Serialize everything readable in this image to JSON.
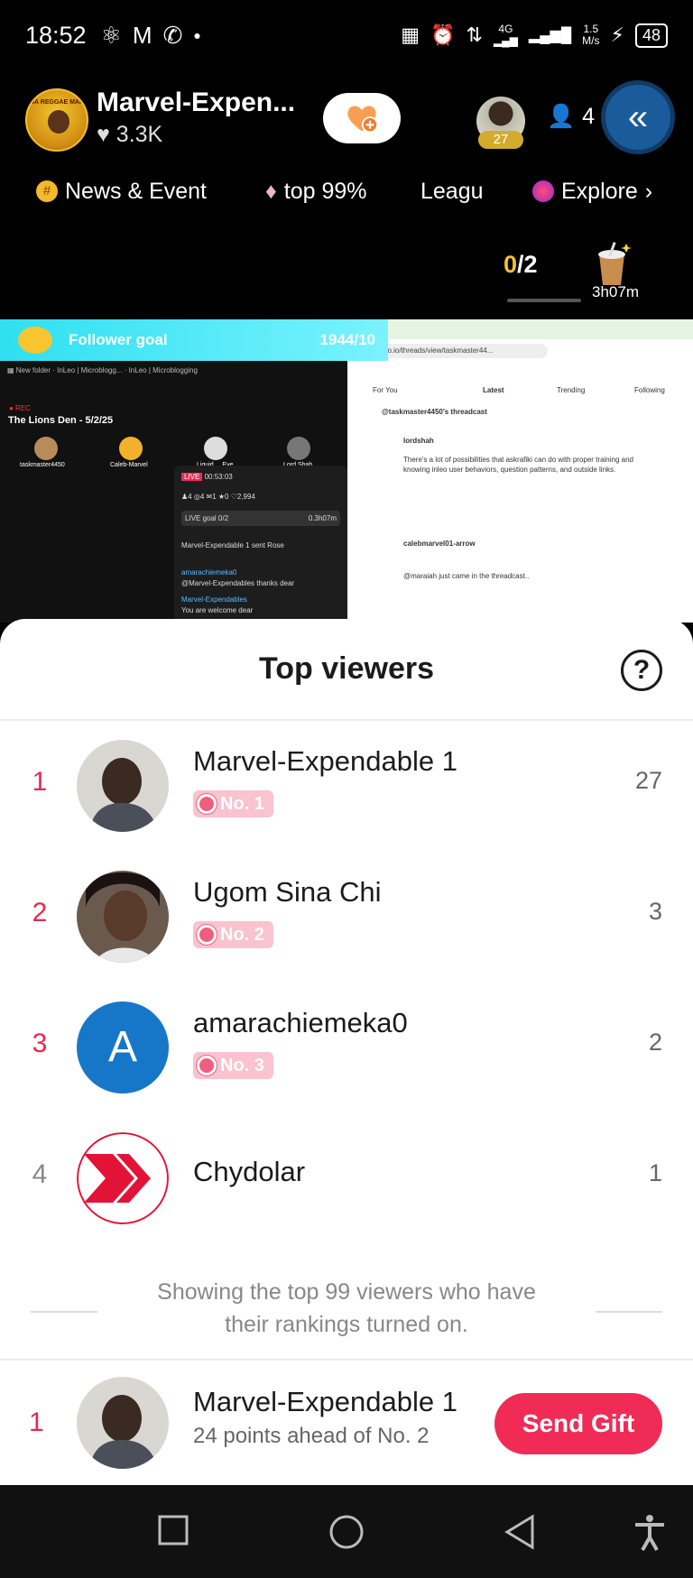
{
  "status_bar": {
    "time": "18:52",
    "net_top": "4G",
    "speed_value": "1.5",
    "speed_unit": "M/s",
    "battery": "48"
  },
  "header": {
    "host_name": "Marvel-Expen...",
    "host_likes": "3.3K",
    "viewer_badge": "27",
    "viewer_count": "4",
    "avatar_text": "DA REGGAE MAN"
  },
  "tabs": [
    {
      "label": "News & Event"
    },
    {
      "label": "top 99%"
    },
    {
      "label": "Leagu"
    },
    {
      "label": "Explore"
    }
  ],
  "goal": {
    "current": "0",
    "total": "/2",
    "timer": "3h07m"
  },
  "shared_screen": {
    "follower_goal_label": "Follower goal",
    "follower_goal_value": "1944/10",
    "room_title": "The Lions Den - 5/2/25",
    "speakers": [
      "taskmaster4450",
      "Caleb-Marvel",
      "Liquid ... Eye",
      "Lord Shah"
    ],
    "live_time": "00:53:03",
    "live_goal": "LIVE goal 0/2",
    "live_goal_timer": "0.3h07m",
    "gift_msg": "Marvel-Expendable 1 sent Rose",
    "chat_1_user": "amarachiemeka0",
    "chat_1_text": "@Marvel-Expendables thanks dear",
    "chat_2_user": "Marvel-Expendables",
    "chat_2_text": "You are welcome dear",
    "url": "inleo.io/threads/view/taskmaster44...",
    "tabs": [
      "For You",
      "Latest",
      "Trending",
      "Following"
    ],
    "thread_title": "@taskmaster4450's threadcast",
    "post_1_user": "lordshah",
    "post_1_text": "There's a lot of possibilities that askrafiki can do with proper training and knowing inleo user behaviors, question patterns, and outside links.",
    "post_2_user": "calebmarvel01-arrow",
    "post_2_text": "@maraiah just came in the threadcast.."
  },
  "sheet": {
    "title": "Top viewers",
    "help": "?",
    "viewers": [
      {
        "rank": "1",
        "name": "Marvel-Expendable 1",
        "badge": "No. 1",
        "score": "27"
      },
      {
        "rank": "2",
        "name": "Ugom Sina Chi",
        "badge": "No. 2",
        "score": "3"
      },
      {
        "rank": "3",
        "name": "amarachiemeka0",
        "badge": "No. 3",
        "score": "2",
        "initial": "A"
      },
      {
        "rank": "4",
        "name": "Chydolar",
        "badge": "",
        "score": "1"
      }
    ],
    "footnote_line1": "Showing the top 99 viewers who have",
    "footnote_line2": "their rankings turned on.",
    "me": {
      "rank": "1",
      "name": "Marvel-Expendable 1",
      "sub": "24 points ahead of No. 2",
      "button": "Send Gift"
    }
  },
  "colors": {
    "accent": "#f02b55",
    "rank_top": "#e8284f",
    "badge_bg": "#f9c3d0",
    "avatar_blue": "#1677c9"
  }
}
